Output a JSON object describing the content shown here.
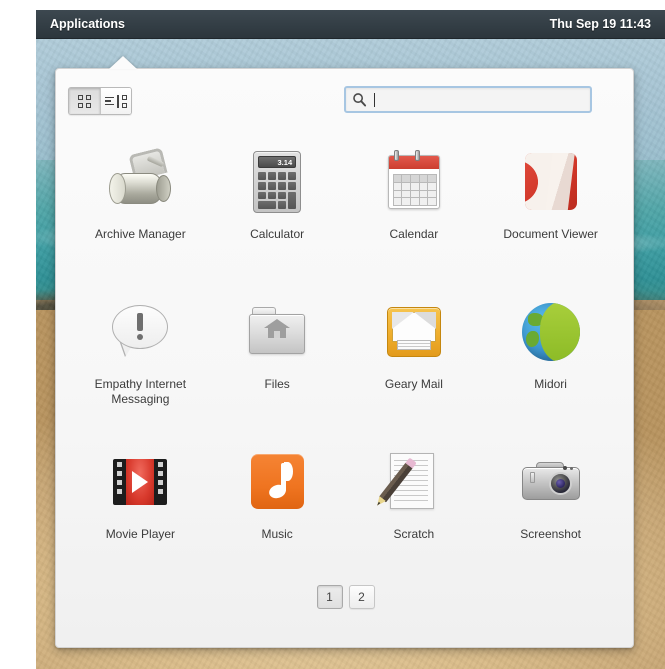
{
  "panel": {
    "applications_label": "Applications",
    "clock": "Thu Sep 19 11:43"
  },
  "popup": {
    "toolbar": {
      "grid_view_icon": "grid-view-icon",
      "list_view_icon": "list-view-icon",
      "active_view": "grid"
    },
    "search": {
      "icon": "search-icon",
      "value": "",
      "placeholder": ""
    },
    "apps": [
      {
        "label": "Archive Manager",
        "icon": "archive-manager-icon"
      },
      {
        "label": "Calculator",
        "icon": "calculator-icon",
        "display_value": "3.14"
      },
      {
        "label": "Calendar",
        "icon": "calendar-icon"
      },
      {
        "label": "Document Viewer",
        "icon": "document-viewer-icon"
      },
      {
        "label": "Empathy Internet Messaging",
        "icon": "empathy-icon"
      },
      {
        "label": "Files",
        "icon": "files-icon"
      },
      {
        "label": "Geary Mail",
        "icon": "geary-mail-icon"
      },
      {
        "label": "Midori",
        "icon": "midori-icon"
      },
      {
        "label": "Movie Player",
        "icon": "movie-player-icon"
      },
      {
        "label": "Music",
        "icon": "music-icon"
      },
      {
        "label": "Scratch",
        "icon": "scratch-icon"
      },
      {
        "label": "Screenshot",
        "icon": "screenshot-icon"
      }
    ],
    "pages": [
      {
        "label": "1",
        "active": true
      },
      {
        "label": "2",
        "active": false
      }
    ]
  },
  "colors": {
    "panel_bg": "#343f46",
    "popup_bg": "#fbfbfb",
    "search_focus_border": "#a7c6e2",
    "label_text": "#3b3b3b",
    "accent_red": "#cc3e30",
    "accent_orange": "#ef7420",
    "accent_yellow": "#efae2d",
    "accent_green": "#8cbb26",
    "accent_blue": "#3f9ad4"
  }
}
